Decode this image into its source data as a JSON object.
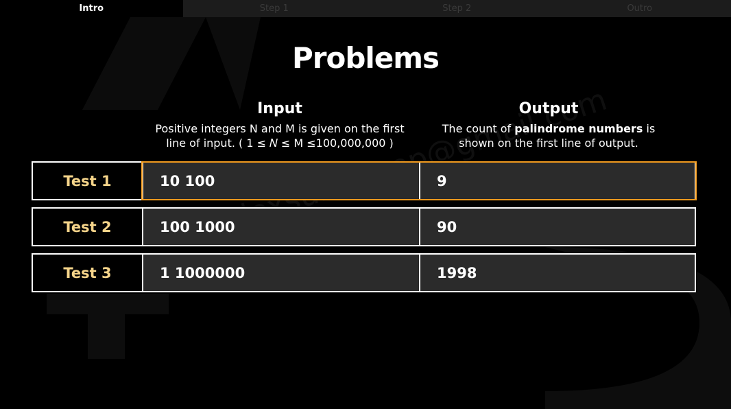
{
  "tabs": [
    {
      "label": "Intro",
      "active": true
    },
    {
      "label": "Step 1",
      "active": false
    },
    {
      "label": "Step 2",
      "active": false
    },
    {
      "label": "Outro",
      "active": false
    }
  ],
  "title": "Problems",
  "input": {
    "heading": "Input",
    "line1": "Positive integers N and M is given on the first",
    "line2": "line of input. ( 1 ≤ 𝑁 ≤ M ≤100,000,000 )"
  },
  "output": {
    "heading": "Output",
    "line1_pre": "The count of ",
    "line1_bold": "palindrome numbers",
    "line1_post": " is",
    "line2": "shown on the first line of output."
  },
  "tests": [
    {
      "label": "Test 1",
      "input": "10 100",
      "output": "9"
    },
    {
      "label": "Test 2",
      "input": "100 1000",
      "output": "90"
    },
    {
      "label": "Test 3",
      "input": "1 1000000",
      "output": "1998"
    }
  ],
  "watermark": "alexsummoop@gmail.com",
  "colors": {
    "accent": "#f09a1e",
    "label": "#f5d48a",
    "cell": "#2b2b2b"
  }
}
